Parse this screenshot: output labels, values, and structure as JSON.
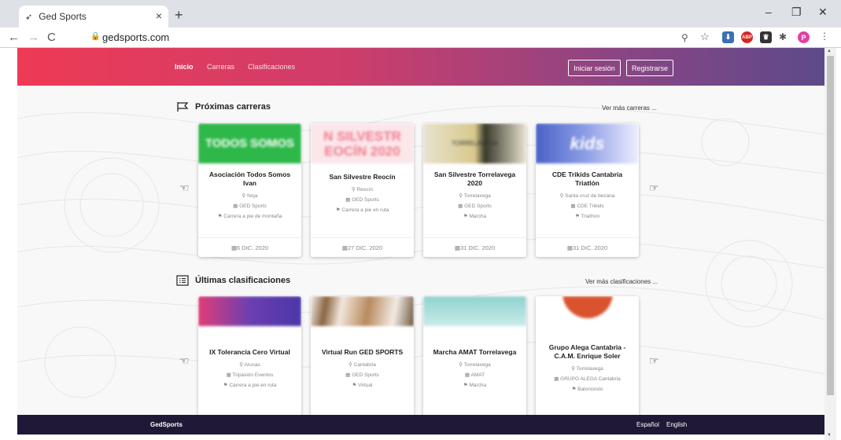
{
  "browser": {
    "tab_title": "Ged Sports",
    "tab_close": "×",
    "new_tab": "+",
    "url": "gedsports.com",
    "controls": {
      "minimize": "–",
      "restore": "❐",
      "close": "✕"
    },
    "profile_initial": "P",
    "abp": "ABP"
  },
  "site": {
    "nav": [
      "Inicio",
      "Carreras",
      "Clasificaciones"
    ],
    "login": "Iniciar sesión",
    "register": "Registrarse",
    "upcoming": {
      "title": "Próximas carreras",
      "more": "Ver más carreras ...",
      "cards": [
        {
          "img_text": "TODOS SOMOS",
          "title": "Asociación Todos Somos Ivan",
          "place": "Noja",
          "org": "GED Sports",
          "type": "Carrera a pie de montaña",
          "date": "6 DIC. 2020"
        },
        {
          "img_text": "N SILVESTR EOCÍN 2020",
          "title": "San Silvestre Reocín",
          "place": "Reocín",
          "org": "GED Sports",
          "type": "Carrera a pie en ruta",
          "date": "27 DIC. 2020"
        },
        {
          "img_text": "TORRELAVEGA",
          "title": "San Silvestre Torrelavega 2020",
          "place": "Torrelavega",
          "org": "GED Sports",
          "type": "Marcha",
          "date": "31 DIC. 2020"
        },
        {
          "img_text": "kids",
          "title": "CDE Trikids Cantabria Triatlón",
          "place": "Santa cruz de bezana",
          "org": "CDE Trikids",
          "type": "Triathon",
          "date": "31 DIC. 2020"
        }
      ]
    },
    "results": {
      "title": "Últimas clasificaciones",
      "more": "Ver más clasificaciones ...",
      "cards": [
        {
          "title": "IX Tolerancia Cero Virtual",
          "place": "Arucas",
          "org": "Tripasión Eventos",
          "type": "Carrera a pie en ruta"
        },
        {
          "title": "Virtual Run GED SPORTS",
          "place": "Cantabria",
          "org": "GED Sports",
          "type": "Virtual"
        },
        {
          "title": "Marcha AMAT Torrelavega",
          "place": "Torrelavega",
          "org": "AMAT",
          "type": "Marcha"
        },
        {
          "title": "Grupo Alega Cantabria - C.A.M. Enrique Soler",
          "place": "Torrelavega",
          "org": "GRUPO ALEGA Cantabria",
          "type": "Baloncesto"
        }
      ]
    },
    "footer": {
      "brand": "GedSports",
      "lang1": "Español",
      "lang2": "English"
    }
  },
  "colors": {
    "gradient_start": "#ee3a55",
    "gradient_end": "#5d4a8a",
    "footer": "#1f1836"
  }
}
